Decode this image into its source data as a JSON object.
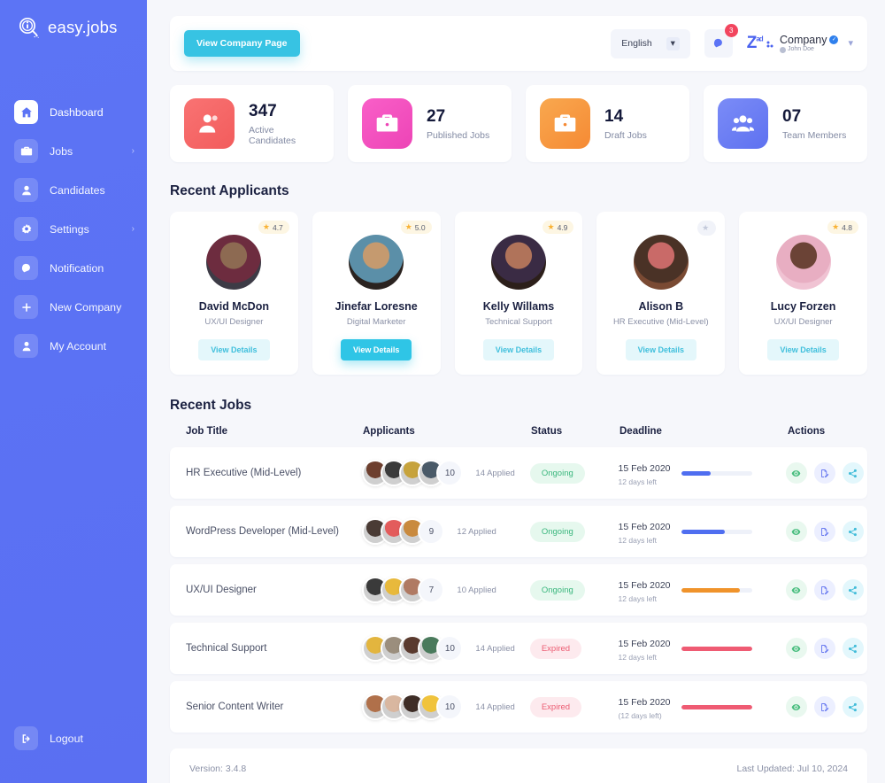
{
  "brand": {
    "name": "easy.jobs",
    "logo_icon": "magnifier-info-icon"
  },
  "sidebar": {
    "items": [
      {
        "label": "Dashboard",
        "icon": "home-icon",
        "active": true,
        "chevron": ""
      },
      {
        "label": "Jobs",
        "icon": "briefcase-icon",
        "active": false,
        "chevron": "›"
      },
      {
        "label": "Candidates",
        "icon": "user-icon",
        "active": false,
        "chevron": ""
      },
      {
        "label": "Settings",
        "icon": "gear-icon",
        "active": false,
        "chevron": "›"
      },
      {
        "label": "Notification",
        "icon": "bell-icon",
        "active": false,
        "chevron": ""
      },
      {
        "label": "New Company",
        "icon": "plus-icon",
        "active": false,
        "chevron": ""
      },
      {
        "label": "My Account",
        "icon": "person-icon",
        "active": false,
        "chevron": ""
      }
    ],
    "logout": {
      "label": "Logout",
      "icon": "logout-icon"
    }
  },
  "topbar": {
    "view_company_label": "View Company Page",
    "language": "English",
    "notification_count": "3",
    "profile": {
      "logo_main": "Z",
      "logo_sup": "ad",
      "company": "Company",
      "user": "John Doe",
      "verified": "✓"
    }
  },
  "stats": [
    {
      "value": "347",
      "label": "Active Candidates",
      "icon": "candidates-icon",
      "c1": "#f97373",
      "c2": "#f25c5c"
    },
    {
      "value": "27",
      "label": "Published Jobs",
      "icon": "briefcase-icon",
      "c1": "#f95fc8",
      "c2": "#ed44b6"
    },
    {
      "value": "14",
      "label": "Draft Jobs",
      "icon": "briefcase-icon",
      "c1": "#f9a84f",
      "c2": "#f58a34"
    },
    {
      "value": "07",
      "label": "Team Members",
      "icon": "team-icon",
      "c1": "#7b8cf7",
      "c2": "#5e71f0"
    }
  ],
  "applicants_section": {
    "title": "Recent Applicants",
    "cards": [
      {
        "name": "David McDon",
        "role": "UX/UI Designer",
        "rating": "4.7",
        "has_rating": true,
        "btn": "View Details",
        "primary": false,
        "av1": "#3d3b46",
        "av2": "#8d6a52",
        "av3": "#6d2c3f"
      },
      {
        "name": "Jinefar Loresne",
        "role": "Digital Marketer",
        "rating": "5.0",
        "has_rating": true,
        "btn": "View Details",
        "primary": true,
        "av1": "#2a2320",
        "av2": "#c59a6f",
        "av3": "#5b8fa8"
      },
      {
        "name": "Kelly Willams",
        "role": "Technical Support",
        "rating": "4.9",
        "has_rating": true,
        "btn": "View Details",
        "primary": false,
        "av1": "#2c1f1a",
        "av2": "#b0735a",
        "av3": "#3a2b44"
      },
      {
        "name": "Alison B",
        "role": "HR Executive (Mid-Level)",
        "rating": "",
        "has_rating": false,
        "btn": "View Details",
        "primary": false,
        "av1": "#7a4a33",
        "av2": "#c96a68",
        "av3": "#4a3226"
      },
      {
        "name": "Lucy Forzen",
        "role": "UX/UI Designer",
        "rating": "4.8",
        "has_rating": true,
        "btn": "View Details",
        "primary": false,
        "av1": "#f0c3d3",
        "av2": "#6b4336",
        "av3": "#e8aec2"
      }
    ]
  },
  "jobs_section": {
    "title": "Recent Jobs",
    "columns": [
      "Job Title",
      "Applicants",
      "Status",
      "Deadline",
      "Actions"
    ],
    "rows": [
      {
        "title": "HR Executive (Mid-Level)",
        "count": "10",
        "applied": "14 Applied",
        "status": "Ongoing",
        "status_kind": "ongoing",
        "date": "15 Feb 2020",
        "days_left": "12 days left",
        "progress": 42,
        "bar_color": "#4f6ef0",
        "avatars": 4,
        "av_colors": [
          "#6d3f2e",
          "#3b3b3b",
          "#c7a33c",
          "#4a5a68"
        ]
      },
      {
        "title": "WordPress Developer (Mid-Level)",
        "count": "9",
        "applied": "12 Applied",
        "status": "Ongoing",
        "status_kind": "ongoing",
        "date": "15 Feb 2020",
        "days_left": "12 days left",
        "progress": 62,
        "bar_color": "#4f6ef0",
        "avatars": 3,
        "av_colors": [
          "#4a3b35",
          "#e35c5c",
          "#c98a3e"
        ]
      },
      {
        "title": "UX/UI Designer",
        "count": "7",
        "applied": "10 Applied",
        "status": "Ongoing",
        "status_kind": "ongoing",
        "date": "15 Feb 2020",
        "days_left": "12 days left",
        "progress": 83,
        "bar_color": "#f0932b",
        "avatars": 3,
        "av_colors": [
          "#3a3a3a",
          "#e8b93c",
          "#b07a63"
        ]
      },
      {
        "title": "Technical Support",
        "count": "10",
        "applied": "14 Applied",
        "status": "Expired",
        "status_kind": "expired",
        "date": "15 Feb 2020",
        "days_left": "12 days left",
        "progress": 100,
        "bar_color": "#ef5b73",
        "avatars": 4,
        "av_colors": [
          "#e3b53e",
          "#9b8e7d",
          "#5a3a2e",
          "#4a7a5c"
        ]
      },
      {
        "title": "Senior Content Writer",
        "count": "10",
        "applied": "14 Applied",
        "status": "Expired",
        "status_kind": "expired",
        "date": "15 Feb 2020",
        "days_left": "(12 days left)",
        "progress": 100,
        "bar_color": "#ef5b73",
        "avatars": 4,
        "av_colors": [
          "#b0704a",
          "#d9b7a0",
          "#3e2d26",
          "#f0c33c"
        ]
      }
    ],
    "action_icons": [
      "eye-icon",
      "edit-document-icon",
      "share-icon"
    ]
  },
  "footer": {
    "version": "Version: 3.4.8",
    "updated": "Last Updated: Jul 10, 2024"
  }
}
